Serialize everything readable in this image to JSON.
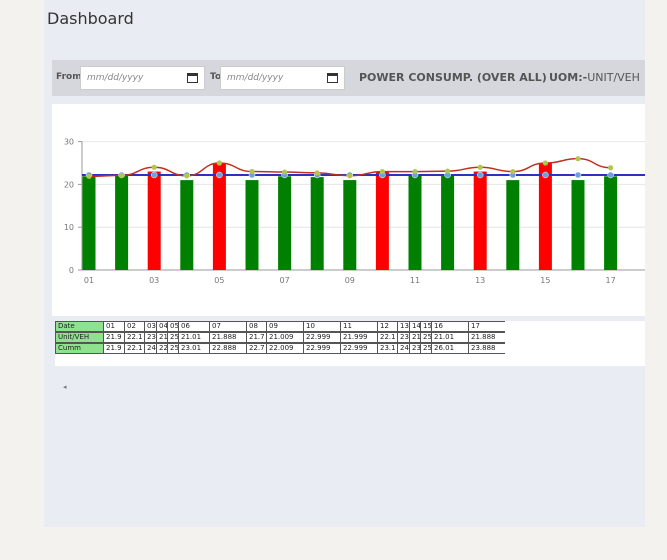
{
  "page": {
    "title": "Dashboard"
  },
  "filters": {
    "from_label": "From",
    "to_label": "To",
    "from_placeholder": "mm/dd/yyyy",
    "to_placeholder": "mm/dd/yyyy",
    "heading": "POWER CONSUMP. (OVER ALL)",
    "uom_label": "UOM:-",
    "uom_value": "UNIT/VEH"
  },
  "colors": {
    "above": "#ff0000",
    "below": "#008000",
    "avg_line": "#3030c0",
    "cumm_line": "#c03020"
  },
  "chart_data": {
    "type": "bar",
    "x_tick_labels": [
      "01",
      "03",
      "05",
      "07",
      "09",
      "11",
      "13",
      "15",
      "17"
    ],
    "y_tick_labels": [
      "0",
      "10",
      "20",
      "30"
    ],
    "ylim": [
      0,
      30
    ],
    "categories": [
      "01",
      "02",
      "03",
      "04",
      "05",
      "06",
      "07",
      "08",
      "09",
      "10",
      "11",
      "12",
      "13",
      "14",
      "15",
      "16",
      "17"
    ],
    "series": [
      {
        "values": [
          21.9,
          22.1,
          23,
          21,
          25,
          21.01,
          21.888,
          21.7,
          21.009,
          22.999,
          21.999,
          22.1,
          23,
          21,
          25,
          21.01,
          21.888
        ]
      },
      {
        "values": [
          21.9,
          22.1,
          24,
          22,
          25,
          23.01,
          22.888,
          22.7,
          22.009,
          22.999,
          22.999,
          23.1,
          24,
          23,
          25,
          26.01,
          23.888
        ]
      }
    ],
    "average": 22.2
  },
  "table": {
    "row_labels": [
      "Date",
      "Unit/VEH",
      "Cumm"
    ],
    "dates": [
      "01",
      "02",
      "03",
      "04",
      "05",
      "06",
      "07",
      "08",
      "09",
      "10",
      "11",
      "12",
      "13",
      "14",
      "15",
      "16",
      "17"
    ],
    "unit": [
      "21.9",
      "22.1",
      "23",
      "21",
      "25",
      "21.01",
      "21.888",
      "21.7",
      "21.009",
      "22.999",
      "21.999",
      "22.1",
      "23",
      "21",
      "25",
      "21.01",
      "21.888"
    ],
    "cumm": [
      "21.9",
      "22.1",
      "24",
      "22",
      "25",
      "23.01",
      "22.888",
      "22.7",
      "22.009",
      "22.999",
      "22.999",
      "23.1",
      "24",
      "23",
      "25",
      "26.01",
      "23.888"
    ]
  },
  "scroll": {
    "left_arrow": "◂"
  }
}
